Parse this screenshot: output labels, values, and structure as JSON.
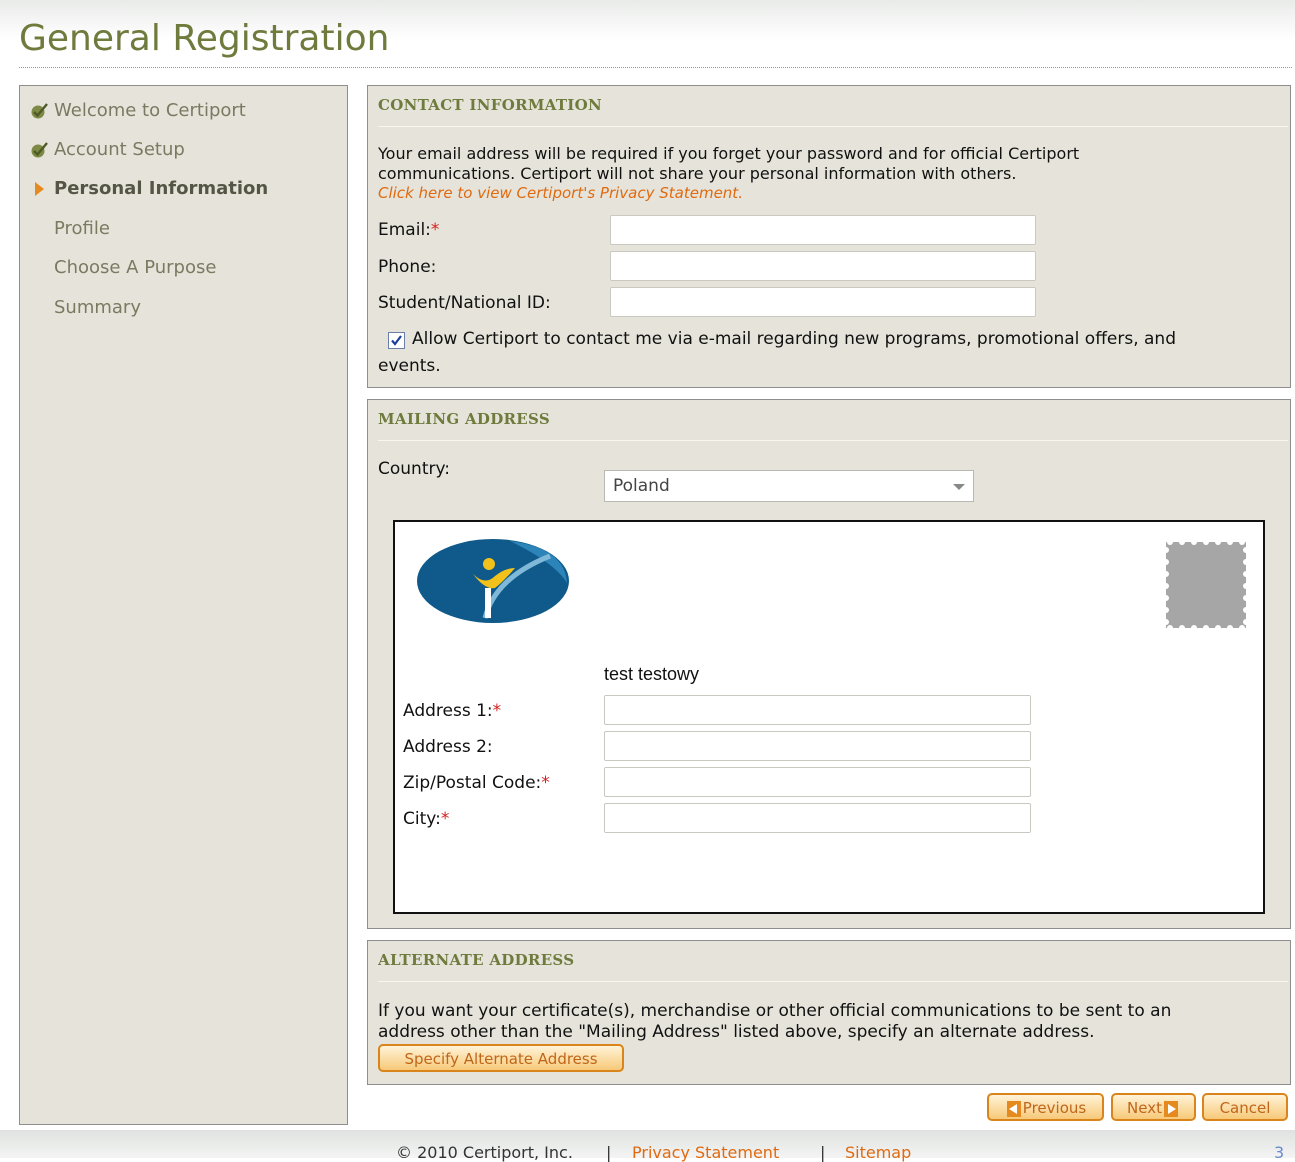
{
  "page": {
    "title": "General Registration"
  },
  "steps": [
    {
      "label": "Welcome to Certiport",
      "state": "done"
    },
    {
      "label": "Account Setup",
      "state": "done"
    },
    {
      "label": "Personal Information",
      "state": "current"
    },
    {
      "label": "Profile",
      "state": "pending"
    },
    {
      "label": "Choose A Purpose",
      "state": "pending"
    },
    {
      "label": "Summary",
      "state": "pending"
    }
  ],
  "contact": {
    "heading": "CONTACT INFORMATION",
    "intro_line1": "Your email address will be required if you forget your password and for official Certiport",
    "intro_line2": "communications. Certiport will not share your personal information with others.",
    "privacy_link": "Click here to view Certiport's Privacy Statement.",
    "email_label": "Email:",
    "phone_label": "Phone:",
    "student_id_label": "Student/National ID:",
    "required_mark": "*",
    "email_value": "",
    "phone_value": "",
    "student_id_value": "",
    "optin_checked": true,
    "optin_line1": "Allow Certiport to contact me via e-mail regarding new programs, promotional offers, and",
    "optin_line2": "events."
  },
  "mailing": {
    "heading": "MAILING ADDRESS",
    "country_label": "Country:",
    "country_value": "Poland",
    "recipient_name": "test testowy",
    "address1_label": "Address 1:",
    "address2_label": "Address 2:",
    "zip_label": "Zip/Postal Code:",
    "city_label": "City:",
    "address1_value": "",
    "address2_value": "",
    "zip_value": "",
    "city_value": ""
  },
  "alternate": {
    "heading": "ALTERNATE ADDRESS",
    "line1": "If you want your certificate(s), merchandise or other official communications to be sent to an",
    "line2": "address other than the \"Mailing Address\" listed above, specify an alternate address.",
    "button": "Specify Alternate Address"
  },
  "nav": {
    "previous": "Previous",
    "next": "Next",
    "cancel": "Cancel"
  },
  "footer": {
    "copyright": "© 2010 Certiport, Inc.",
    "separator": "|",
    "privacy": "Privacy Statement",
    "sitemap": "Sitemap",
    "page_number": "3"
  },
  "colors": {
    "heading_olive": "#6f7a3d",
    "panel_bg": "#e6e4da",
    "link_orange": "#e06a10",
    "required_red": "#d42020",
    "logo_blue": "#0f5a8a",
    "logo_yellow": "#f2c21a"
  },
  "icons": {
    "done_step": "checkmark-icon",
    "current_step": "arrow-right-icon",
    "stamp": "postage-stamp-icon"
  }
}
